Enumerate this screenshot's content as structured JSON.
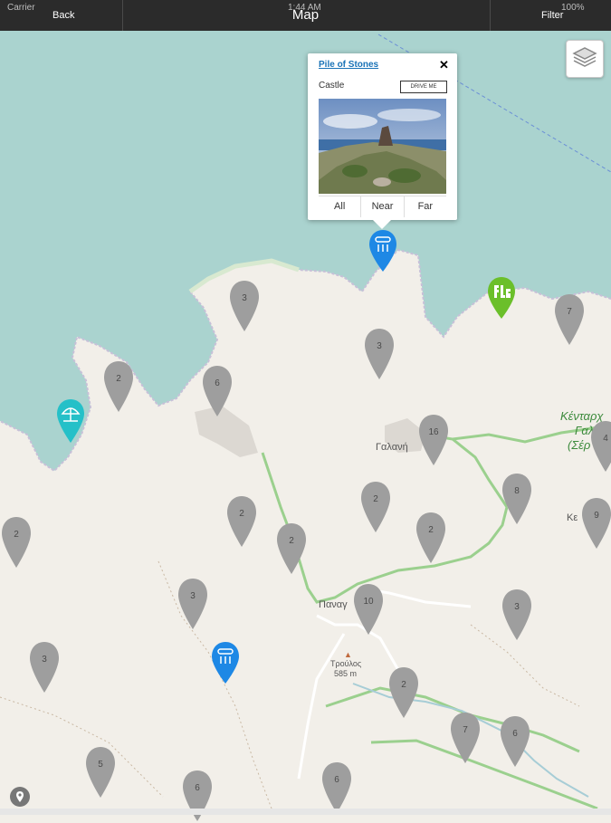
{
  "navbar": {
    "status_carrier": "Carrier",
    "status_time": "1:44 AM",
    "status_battery": "100%",
    "back_label": "Back",
    "title": "Map",
    "filter_label": "Filter"
  },
  "popup": {
    "title": "Pile of Stones",
    "category": "Castle",
    "drive_label": "DRIVE ME",
    "close_label": "✕",
    "tabs": [
      "All",
      "Near",
      "Far"
    ]
  },
  "map_labels": {
    "galani": "Γαλανή",
    "panagia": "Παναγ",
    "troulos": "Τρούλος",
    "troulos_elev": "585 m",
    "kentro_1": "Κένταρχ",
    "kentro_2": "Γαλ",
    "kentro_3": "(Σέρ",
    "edge_ke": "Κε"
  },
  "clusters": [
    {
      "count": "3"
    },
    {
      "count": "2"
    },
    {
      "count": "6"
    },
    {
      "count": "3"
    },
    {
      "count": "16"
    },
    {
      "count": "7"
    },
    {
      "count": "4"
    },
    {
      "count": "2"
    },
    {
      "count": "2"
    },
    {
      "count": "2"
    },
    {
      "count": "8"
    },
    {
      "count": "2"
    },
    {
      "count": "9"
    },
    {
      "count": "2"
    },
    {
      "count": "3"
    },
    {
      "count": "10"
    },
    {
      "count": "3"
    },
    {
      "count": "3"
    },
    {
      "count": "2"
    },
    {
      "count": "7"
    },
    {
      "count": "6"
    },
    {
      "count": "5"
    },
    {
      "count": "6"
    },
    {
      "count": "6"
    }
  ],
  "poi_pins": [
    {
      "icon": "dining-icon",
      "color": "#1e88e5"
    },
    {
      "icon": "hike-icon",
      "color": "#6bbf2a"
    },
    {
      "icon": "beach-icon",
      "color": "#25c0c8"
    },
    {
      "icon": "dining-icon",
      "color": "#1e88e5"
    }
  ],
  "colors": {
    "sea": "#aad3cf",
    "land": "#f2efe9",
    "cluster": "#9e9e9e",
    "nav_bg": "#2b2b2b"
  }
}
